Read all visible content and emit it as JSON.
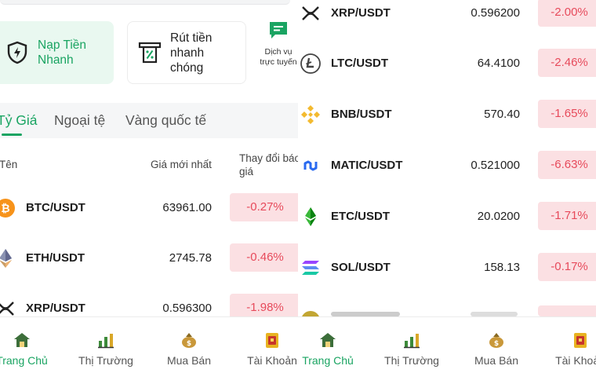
{
  "left": {
    "actions": {
      "deposit_label": "Nạp Tiền Nhanh",
      "withdraw_label": "Rút tiền nhanh chóng",
      "service_label": "Dịch vụ trực tuyến"
    },
    "tabs": [
      {
        "label": "Tỷ Giá",
        "active": true
      },
      {
        "label": "Ngoại tệ",
        "active": false
      },
      {
        "label": "Vàng quốc tế",
        "active": false
      }
    ],
    "columns": {
      "name": "Tên",
      "price": "Giá mới nhất",
      "change": "Thay đổi báo giá"
    },
    "rows": [
      {
        "pair": "BTC/USDT",
        "price": "63961.00",
        "change": "-0.27%",
        "icon": "bitcoin-icon"
      },
      {
        "pair": "ETH/USDT",
        "price": "2745.78",
        "change": "-0.46%",
        "icon": "ethereum-icon"
      },
      {
        "pair": "XRP/USDT",
        "price": "0.596300",
        "change": "-1.98%",
        "icon": "xrp-icon"
      }
    ]
  },
  "right": {
    "rows": [
      {
        "pair": "XRP/USDT",
        "price": "0.596200",
        "change": "-2.00%",
        "icon": "xrp-icon"
      },
      {
        "pair": "LTC/USDT",
        "price": "64.4100",
        "change": "-2.46%",
        "icon": "litecoin-icon"
      },
      {
        "pair": "BNB/USDT",
        "price": "570.40",
        "change": "-1.65%",
        "icon": "bnb-icon"
      },
      {
        "pair": "MATIC/USDT",
        "price": "0.521000",
        "change": "-6.63%",
        "icon": "matic-icon"
      },
      {
        "pair": "ETC/USDT",
        "price": "20.0200",
        "change": "-1.71%",
        "icon": "ethereum-classic-icon"
      },
      {
        "pair": "SOL/USDT",
        "price": "158.13",
        "change": "-0.17%",
        "icon": "solana-icon"
      }
    ]
  },
  "nav": [
    {
      "label": "Trang Chủ",
      "icon": "home-icon",
      "active": true
    },
    {
      "label": "Thị Trường",
      "icon": "market-icon",
      "active": false
    },
    {
      "label": "Mua Bán",
      "icon": "trade-icon",
      "active": false
    },
    {
      "label": "Tài Khoản",
      "icon": "account-icon",
      "active": false
    }
  ],
  "colors": {
    "accent": "#1aa462",
    "negative": "#e74a5b",
    "negative_bg": "#fbe0e3"
  }
}
